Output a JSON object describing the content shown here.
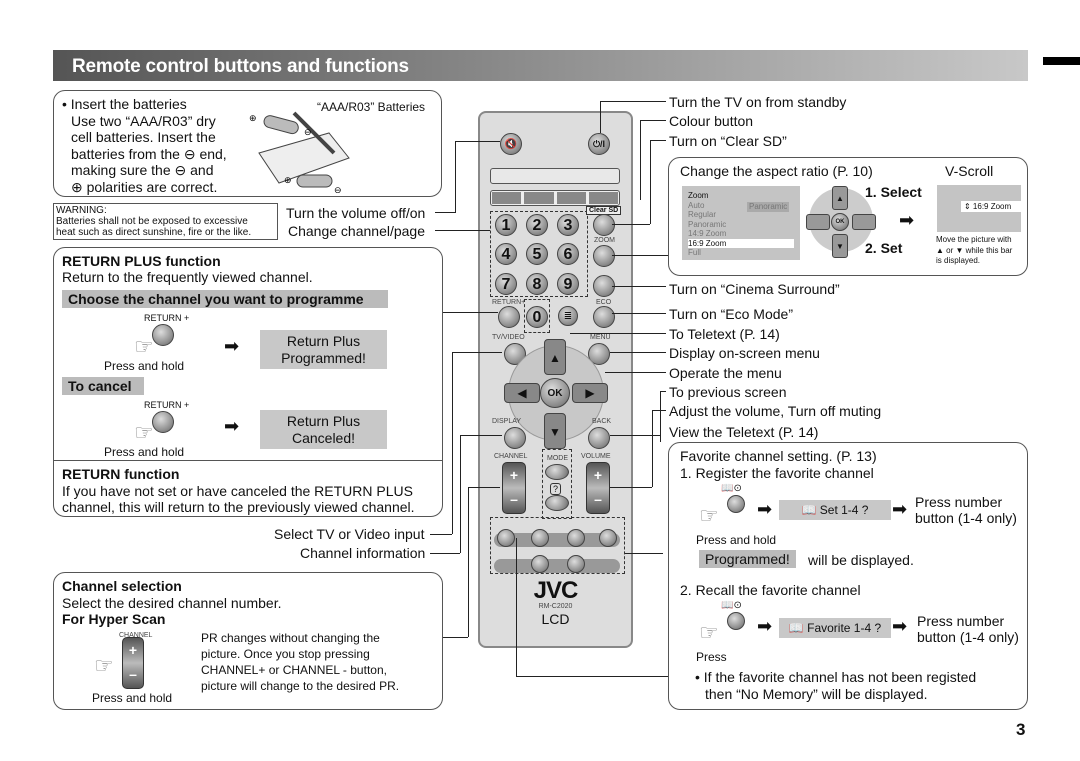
{
  "header": {
    "title": "Remote control buttons and functions"
  },
  "page_number": "3",
  "batteries": {
    "lines": [
      "• Insert the batteries",
      "Use two “AAA/R03” dry",
      "cell batteries. Insert the",
      "batteries from the ⊖ end,",
      "making sure the ⊖ and",
      "⊕ polarities are correct."
    ],
    "image_label": "“AAA/R03” Batteries"
  },
  "warning": {
    "title": "WARNING:",
    "lines": [
      "Batteries shall not be exposed to excessive",
      "heat such as direct sunshine, fire or the like."
    ]
  },
  "left_callouts": {
    "volume": "Turn the volume off/on",
    "channel_page": "Change channel/page",
    "tv_video": "Select TV or Video input",
    "channel_info": "Channel information"
  },
  "return_plus": {
    "title": "RETURN PLUS function",
    "desc": "Return to the frequently viewed channel.",
    "choose_bar": "Choose the channel you want to programme",
    "button_label": "RETURN +",
    "press_hold": "Press and hold",
    "programmed_msg": [
      "Return Plus",
      "Programmed!"
    ],
    "cancel_bar": "To cancel",
    "canceled_msg": [
      "Return Plus",
      "Canceled!"
    ]
  },
  "return_function": {
    "title": "RETURN function",
    "lines": [
      "If you have not set or have canceled the RETURN PLUS",
      "channel, this will return to the previously viewed channel."
    ]
  },
  "channel_selection": {
    "title": "Channel selection",
    "desc": "Select the desired channel number.",
    "hyper_title": "For Hyper Scan",
    "button_label": "CHANNEL",
    "press_hold": "Press and hold",
    "lines": [
      "PR changes without changing the",
      "picture. Once you stop pressing",
      "CHANNEL+ or CHANNEL - button,",
      "picture will change to the desired PR."
    ]
  },
  "remote": {
    "mute_icon": "🔇",
    "power": "⏻/I",
    "clear_sd": "Clear SD",
    "numbers": [
      "1",
      "2",
      "3",
      "4",
      "5",
      "6",
      "7",
      "8",
      "9",
      "0"
    ],
    "labels": {
      "zoom": "ZOOM",
      "return": "RETURN+",
      "eco": "ECO",
      "tv_video": "TV/VIDEO",
      "menu": "MENU",
      "ok": "OK",
      "display": "DISPLAY",
      "back": "BACK",
      "channel": "CHANNEL",
      "mode": "MODE",
      "volume": "VOLUME",
      "plus": "+",
      "minus": "–",
      "help": "?"
    },
    "brand": "JVC",
    "model": "RM-C2020",
    "type": "LCD"
  },
  "right_callouts": {
    "power": "Turn the TV on from standby",
    "colour": "Colour button",
    "clear_sd": "Turn on “Clear SD”",
    "cinema": "Turn on “Cinema Surround”",
    "eco": "Turn on “Eco Mode”",
    "teletext_to": "To Teletext (P. 14)",
    "menu": "Display on-screen menu",
    "operate": "Operate the menu",
    "previous": "To previous screen",
    "volume": "Adjust the volume, Turn off muting",
    "view_teletext": "View the Teletext (P. 14)"
  },
  "aspect": {
    "title": "Change the aspect ratio (P. 10)",
    "vscroll_title": "V-Scroll",
    "menu_title": "Zoom",
    "items": [
      "Auto",
      "Regular",
      "Panoramic",
      "14:9 Zoom",
      "16:9 Zoom",
      "Full"
    ],
    "selected": "16:9 Zoom",
    "current_tag": "Panoramic",
    "step1": "1. Select",
    "step2": "2. Set",
    "vscroll_bar": "⇕ 16:9 Zoom",
    "vscroll_note": [
      "Move the picture with",
      "▲ or ▼ while this bar",
      "is displayed."
    ]
  },
  "favorite": {
    "title": "Favorite channel setting. (P. 13)",
    "step1": "1. Register the favorite channel",
    "set_msg": "📖 Set 1-4 ?",
    "press_number": [
      "Press number",
      "button (1-4 only)"
    ],
    "press_hold": "Press and hold",
    "programmed": "Programmed!",
    "will_display": "will be displayed.",
    "step2": "2. Recall the favorite channel",
    "fav_msg": "📖 Favorite 1-4 ?",
    "press": "Press",
    "note": [
      "• If the favorite channel has not been registed",
      "then “No Memory” will be displayed."
    ],
    "icon_label": "📖⊙"
  }
}
